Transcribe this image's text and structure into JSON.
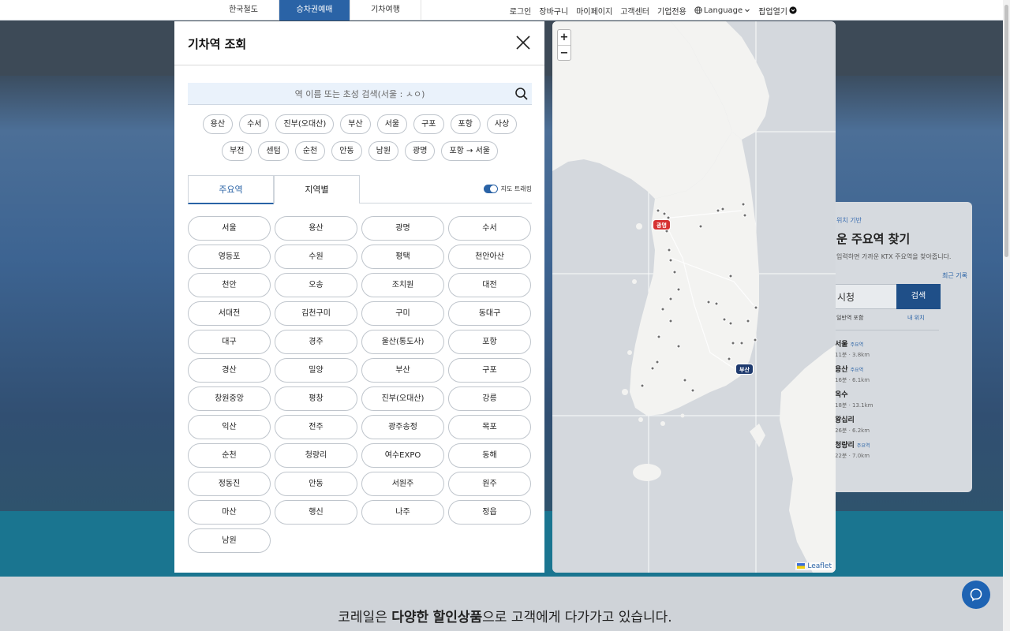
{
  "topbar": {
    "tabs": [
      "한국철도",
      "승차권예매",
      "기차여행"
    ],
    "util": [
      "로그인",
      "장바구니",
      "마이페이지",
      "고객센터",
      "기업전용",
      "Language",
      "팝업열기"
    ]
  },
  "background": {
    "card_label": "위치 기반",
    "card_title": "운 주요역 찾기",
    "card_desc": "입력하면 가까운 KTX 주요역을 찾아줍니다.",
    "recent": "최근 기록",
    "input_value": "시청",
    "search_btn": "검색",
    "include": "일반역 포함",
    "my_location": "내 위치",
    "results": [
      {
        "name": "서울",
        "tag": "주요역",
        "meta": "11분 · 3.8km"
      },
      {
        "name": "용산",
        "tag": "주요역",
        "meta": "16분 · 6.1km"
      },
      {
        "name": "옥수",
        "tag": "",
        "meta": "18분 · 13.1km"
      },
      {
        "name": "왕십리",
        "tag": "",
        "meta": "26분 · 6.2km"
      },
      {
        "name": "청량리",
        "tag": "주요역",
        "meta": "22분 · 7.0km"
      }
    ],
    "bottom_prefix": "코레일은",
    "bottom_b1": "다양한",
    "bottom_b2": "할인상품",
    "bottom_suffix": "으로 고객에게 다가가고 있습니다."
  },
  "modal": {
    "title": "기차역 조회",
    "search_placeholder": "역 이름 또는 초성 검색(서울 : ㅅㅇ)",
    "quick_chips": [
      "용산",
      "수서",
      "진부(오대산)",
      "부산",
      "서울",
      "구포",
      "포항",
      "사상",
      "부전",
      "센텀",
      "순천",
      "안동",
      "남원",
      "광명",
      "포항 → 서울"
    ],
    "tab_major": "주요역",
    "tab_region": "지역별",
    "map_toggle_label": "지도 트래킹",
    "stations": [
      "서울",
      "용산",
      "광명",
      "수서",
      "영등포",
      "수원",
      "평택",
      "천안아산",
      "천안",
      "오송",
      "조치원",
      "대전",
      "서대전",
      "김천구미",
      "구미",
      "동대구",
      "대구",
      "경주",
      "울산(통도사)",
      "포항",
      "경산",
      "밀양",
      "부산",
      "구포",
      "창원중앙",
      "평창",
      "진부(오대산)",
      "강릉",
      "익산",
      "전주",
      "광주송정",
      "목포",
      "순천",
      "청량리",
      "여수EXPO",
      "동해",
      "정동진",
      "안동",
      "서원주",
      "원주",
      "마산",
      "행신",
      "나주",
      "정읍",
      "남원"
    ]
  },
  "map": {
    "zoom_in": "+",
    "zoom_out": "−",
    "marker_gwangmyeong": "광명",
    "marker_busan": "부산",
    "attribution": "Leaflet"
  },
  "colors": {
    "accent": "#2a63a6",
    "marker_red": "#d63232",
    "marker_navy": "#1e3a6e"
  }
}
